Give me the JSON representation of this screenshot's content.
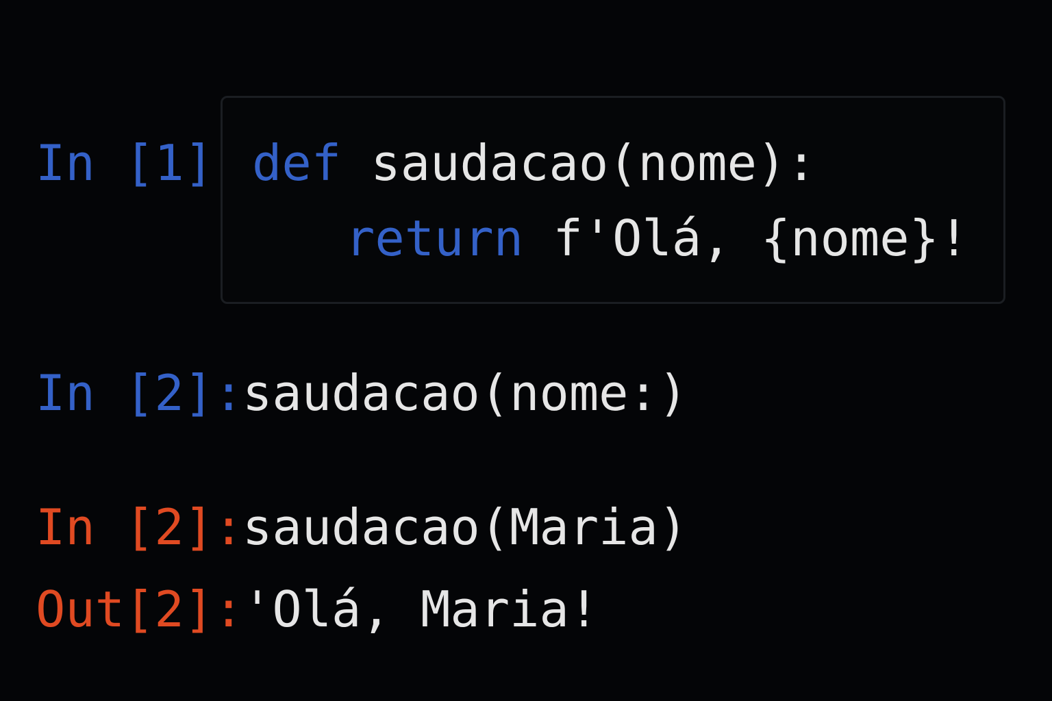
{
  "colors": {
    "background": "#040507",
    "prompt_in": "#3461c8",
    "prompt_out": "#e04a22",
    "code_text": "#e6e6e6",
    "keyword": "#3461c8"
  },
  "cells": [
    {
      "prompt": "In [1]:",
      "lines": [
        {
          "keyword": "def",
          "text": " saudacao(nome):"
        },
        {
          "keyword": "return",
          "text": " f'Olá, {nome}!"
        }
      ]
    },
    {
      "prompt": "In [2]:",
      "code": "saudacao(nome:)"
    },
    {
      "prompt": "In [2]:",
      "code": "saudacao(Maria)"
    },
    {
      "prompt": "Out[2]:",
      "code": "'Olá, Maria!"
    }
  ]
}
